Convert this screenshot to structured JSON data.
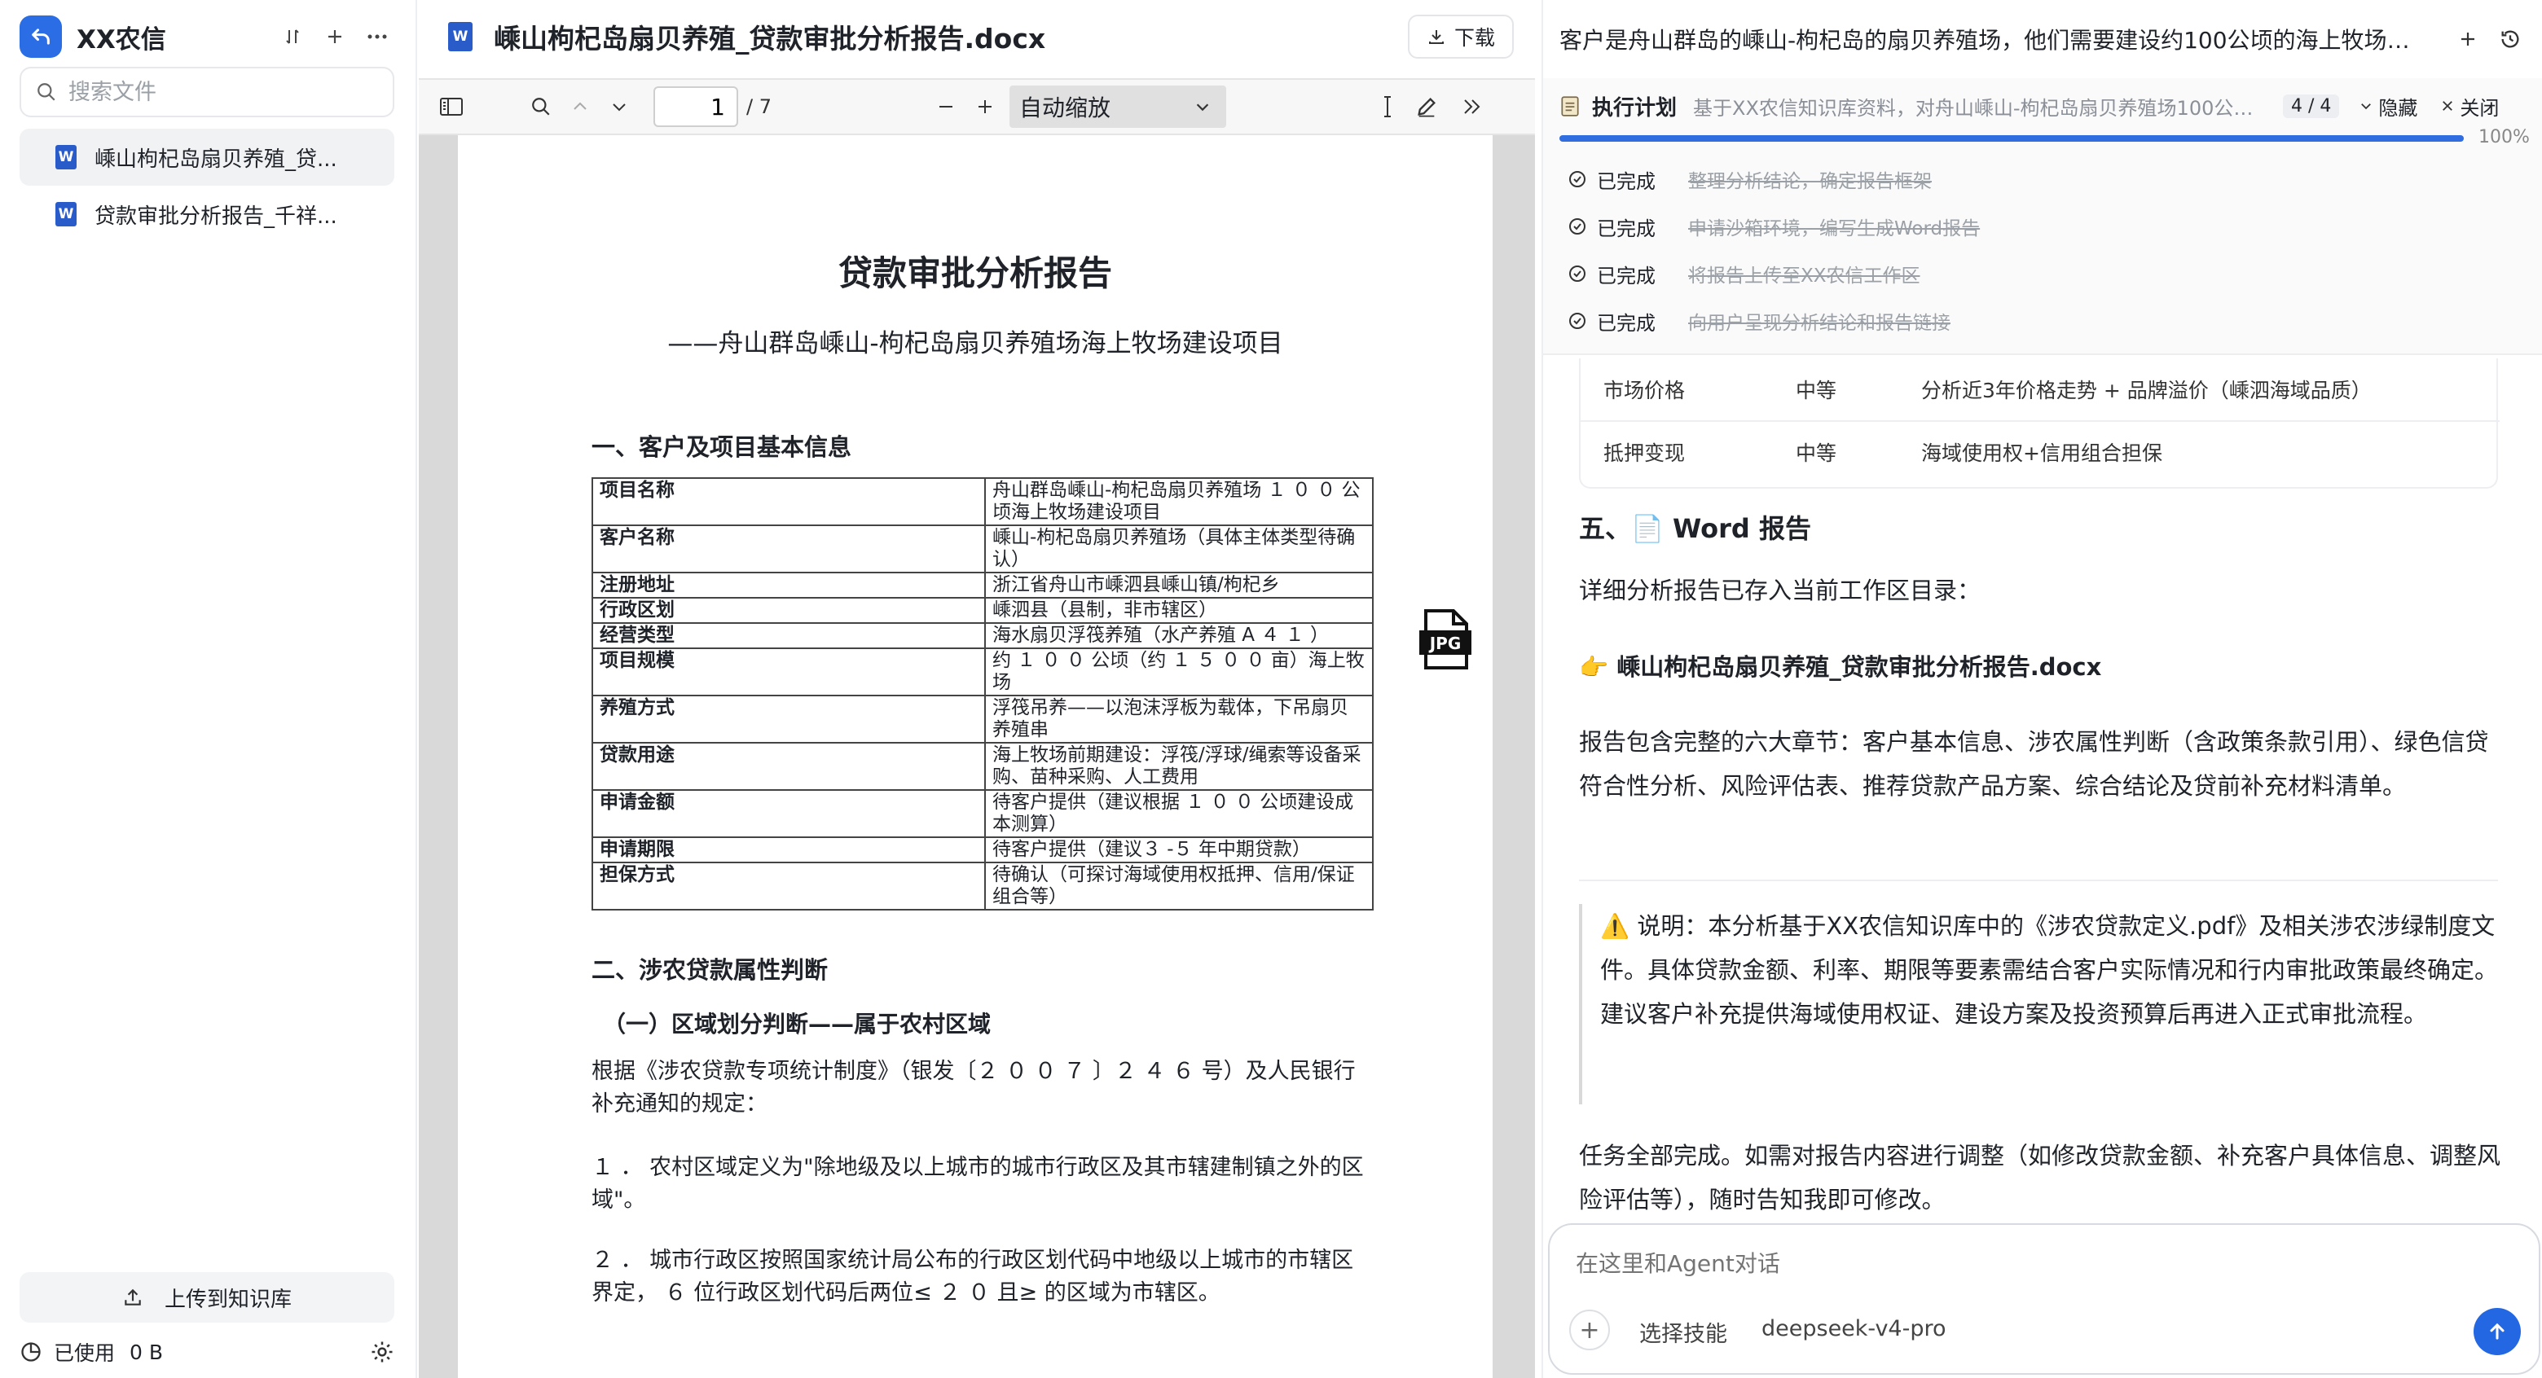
{
  "sidebar": {
    "app_title": "XX农信",
    "search_placeholder": "搜索文件",
    "files": [
      {
        "name": "嵊山枸杞岛扇贝养殖_贷...",
        "active": true
      },
      {
        "name": "贷款审批分析报告_千祥...",
        "active": false
      }
    ],
    "upload_label": "上传到知识库",
    "usage_label": "已使用",
    "usage_value": "0 B"
  },
  "viewer": {
    "doc_title": "嵊山枸杞岛扇贝养殖_贷款审批分析报告.docx",
    "download_label": "下载",
    "page_current": "1",
    "page_total": "/ 7",
    "zoom": "自动缩放",
    "page": {
      "title": "贷款审批分析报告",
      "subtitle": "——舟山群岛嵊山-枸杞岛扇贝养殖场海上牧场建设项目",
      "sec1": "一、客户及项目基本信息",
      "table": [
        {
          "k": "项目名称",
          "v": "舟山群岛嵊山-枸杞岛扇贝养殖场 １ ０ ０ 公顷海上牧场建设项目"
        },
        {
          "k": "客户名称",
          "v": "嵊山-枸杞岛扇贝养殖场（具体主体类型待确认）"
        },
        {
          "k": "注册地址",
          "v": "浙江省舟山市嵊泗县嵊山镇/枸杞乡"
        },
        {
          "k": "行政区划",
          "v": "嵊泗县（县制，非市辖区）"
        },
        {
          "k": "经营类型",
          "v": "海水扇贝浮筏养殖（水产养殖 A ４ １ ）"
        },
        {
          "k": "项目规模",
          "v": "约 １ ０ ０ 公顷（约 １ ５ ０ ０ 亩）海上牧场"
        },
        {
          "k": "养殖方式",
          "v": "浮筏吊养——以泡沫浮板为载体，下吊扇贝养殖串"
        },
        {
          "k": "贷款用途",
          "v": "海上牧场前期建设：浮筏/浮球/绳索等设备采购、苗种采购、人工费用"
        },
        {
          "k": "申请金额",
          "v": "待客户提供（建议根据 １ ０ ０ 公顷建设成本测算）"
        },
        {
          "k": "申请期限",
          "v": "待客户提供（建议３ -５ 年中期贷款）"
        },
        {
          "k": "担保方式",
          "v": "待确认（可探讨海域使用权抵押、信用/保证组合等）"
        }
      ],
      "sec2": "二、涉农贷款属性判断",
      "subsec": "（一）区域划分判断——属于农村区域",
      "p1": "根据《涉农贷款专项统计制度》（银发〔２ ０ ０ ７ 〕２ ４ ６ 号）及人民银行补充通知的规定：",
      "p2": "１ ．  农村区域定义为\"除地级及以上城市的城市行政区及其市辖建制镇之外的区域\"。",
      "p3": "２ ．  城市行政区按照国家统计局公布的行政区划代码中地级以上城市的市辖区界定， ６ 位行政区划代码后两位≤ ２ ０ 且≥ 的区域为市辖区。",
      "badge": "JPG"
    }
  },
  "chat": {
    "title": "客户是舟山群岛的嵊山-枸杞岛的扇贝养殖场，他们需要建设约100公顷的海上牧场，就...",
    "plan": {
      "label": "执行计划",
      "desc": "基于XX农信知识库资料，对舟山嵊山-枸杞岛扇贝养殖场100公顷海...",
      "count": "4 / 4",
      "hide": "隐藏",
      "close": "关闭",
      "progress_pct": "100%",
      "progress_value": 1.0,
      "steps": [
        {
          "status": "已完成",
          "text": "整理分析结论，确定报告框架"
        },
        {
          "status": "已完成",
          "text": "申请沙箱环境，编写生成Word报告"
        },
        {
          "status": "已完成",
          "text": "将报告上传至XX农信工作区"
        },
        {
          "status": "已完成",
          "text": "向用户呈现分析结论和报告链接"
        }
      ]
    },
    "risk_rows": [
      {
        "item": "市场价格",
        "level": "中等",
        "desc": "分析近3年价格走势 + 品牌溢价（嵊泗海域品质）"
      },
      {
        "item": "抵押变现",
        "level": "中等",
        "desc": "海域使用权+信用组合担保"
      }
    ],
    "section5_title": "五、📄 Word 报告",
    "p_saved": "详细分析报告已存入当前工作区目录：",
    "file_link": "👉 嵊山枸杞岛扇贝养殖_贷款审批分析报告.docx",
    "p_contents": "报告包含完整的六大章节：客户基本信息、涉农属性判断（含政策条款引用）、绿色信贷符合性分析、风险评估表、推荐贷款产品方案、综合结论及贷前补充材料清单。",
    "note": "⚠️ 说明：本分析基于XX农信知识库中的《涉农贷款定义.pdf》及相关涉农涉绿制度文件。具体贷款金额、利率、期限等要素需结合客户实际情况和行内审批政策最终确定。建议客户补充提供海域使用权证、建设方案及投资预算后再进入正式审批流程。",
    "p_done": "任务全部完成。如需对报告内容进行调整（如修改贷款金额、补充客户具体信息、调整风险评估等），随时告知我即可修改。",
    "input_placeholder": "在这里和Agent对话",
    "skill_label": "选择技能",
    "model_label": "deepseek-v4-pro"
  },
  "colors": {
    "accent": "#2467e3",
    "word_blue": "#2a5cc9",
    "strikethrough": "#9aa0a6"
  }
}
